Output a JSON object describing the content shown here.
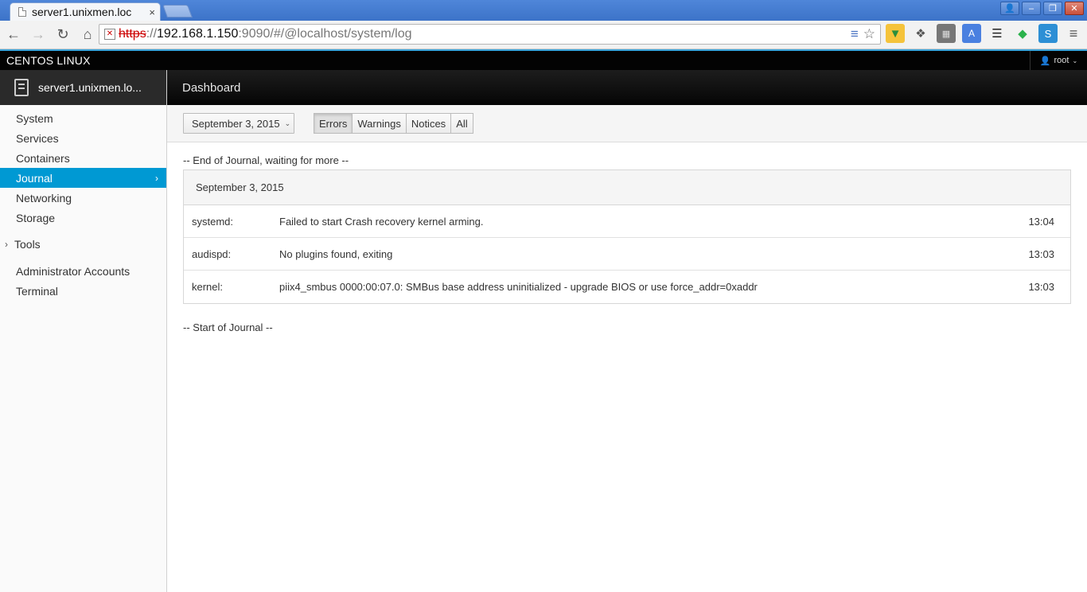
{
  "browser": {
    "tab_title": "server1.unixmen.loc",
    "tab_close": "×",
    "url": {
      "protocol": "https",
      "separator": "://",
      "host": "192.168.1.150",
      "path": ":9090/#/@localhost/system/log"
    },
    "window_buttons": {
      "user": "👤",
      "minimize": "–",
      "maximize": "❐",
      "close": "✕"
    }
  },
  "app": {
    "brand": "CENTOS LINUX",
    "user": "root",
    "host_name": "server1.unixmen.lo...",
    "page_title": "Dashboard",
    "accent_color": "#0099d3"
  },
  "sidebar": {
    "items": [
      {
        "label": "System"
      },
      {
        "label": "Services"
      },
      {
        "label": "Containers"
      },
      {
        "label": "Journal",
        "active": true
      },
      {
        "label": "Networking"
      },
      {
        "label": "Storage"
      },
      {
        "label": "Tools"
      },
      {
        "label": "Administrator Accounts"
      },
      {
        "label": "Terminal"
      }
    ]
  },
  "filters": {
    "date": "September 3, 2015",
    "priorities": [
      "Errors",
      "Warnings",
      "Notices",
      "All"
    ],
    "active_priority": "Errors"
  },
  "journal": {
    "end_note": "-- End of Journal, waiting for more --",
    "day": "September 3, 2015",
    "entries": [
      {
        "ident": "systemd:",
        "message": "Failed to start Crash recovery kernel arming.",
        "time": "13:04"
      },
      {
        "ident": "audispd:",
        "message": "No plugins found, exiting",
        "time": "13:03"
      },
      {
        "ident": "kernel:",
        "message": "piix4_smbus 0000:00:07.0: SMBus base address uninitialized - upgrade BIOS or use force_addr=0xaddr",
        "time": "13:03"
      }
    ],
    "start_note": "-- Start of Journal --"
  }
}
